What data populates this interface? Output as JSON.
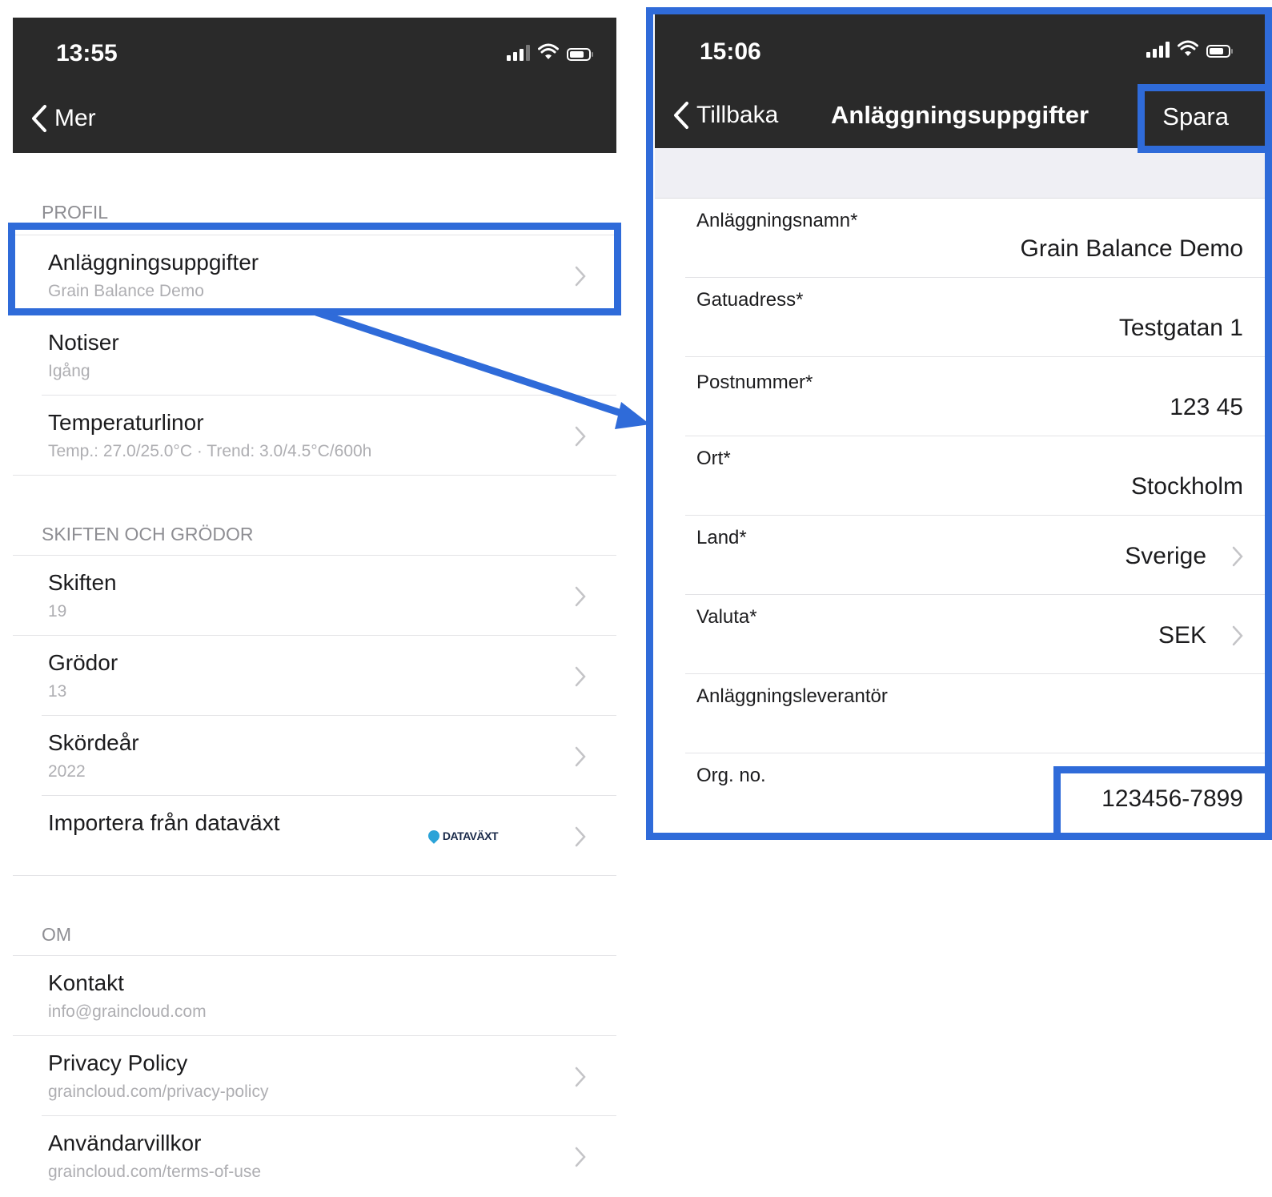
{
  "left": {
    "status": {
      "time": "13:55"
    },
    "nav": {
      "back_label": "Mer"
    },
    "sections": [
      {
        "header": "PROFIL",
        "items": [
          {
            "title": "Anläggningsuppgifter",
            "subtitle": "Grain Balance Demo"
          },
          {
            "title": "Notiser",
            "subtitle": "Igång"
          },
          {
            "title": "Temperaturlinor",
            "subtitle": "Temp.: 27.0/25.0°C · Trend: 3.0/4.5°C/600h"
          }
        ]
      },
      {
        "header": "SKIFTEN OCH GRÖDOR",
        "items": [
          {
            "title": "Skiften",
            "subtitle": "19"
          },
          {
            "title": "Grödor",
            "subtitle": "13"
          },
          {
            "title": "Skördeår",
            "subtitle": "2022"
          },
          {
            "title": "Importera från dataväxt",
            "logo_text": "DATAVÄXT"
          }
        ]
      },
      {
        "header": "OM",
        "items": [
          {
            "title": "Kontakt",
            "subtitle": "info@graincloud.com"
          },
          {
            "title": "Privacy Policy",
            "subtitle": "graincloud.com/privacy-policy"
          },
          {
            "title": "Användarvillkor",
            "subtitle": "graincloud.com/terms-of-use"
          }
        ]
      }
    ]
  },
  "right": {
    "status": {
      "time": "15:06"
    },
    "nav": {
      "back_label": "Tillbaka",
      "title": "Anläggningsuppgifter",
      "action_label": "Spara"
    },
    "fields": [
      {
        "label": "Anläggningsnamn*",
        "value": "Grain Balance Demo"
      },
      {
        "label": "Gatuadress*",
        "value": "Testgatan 1"
      },
      {
        "label": "Postnummer*",
        "value": "123 45"
      },
      {
        "label": "Ort*",
        "value": "Stockholm"
      },
      {
        "label": "Land*",
        "value": "Sverige"
      },
      {
        "label": "Valuta*",
        "value": "SEK"
      },
      {
        "label": "Anläggningsleverantör",
        "value": ""
      },
      {
        "label": "Org. no.",
        "value": "123456-7899"
      }
    ]
  },
  "colors": {
    "highlight": "#2f6bd9",
    "navbar": "#2a2a2a",
    "secondary_text": "#aeaeb2"
  }
}
